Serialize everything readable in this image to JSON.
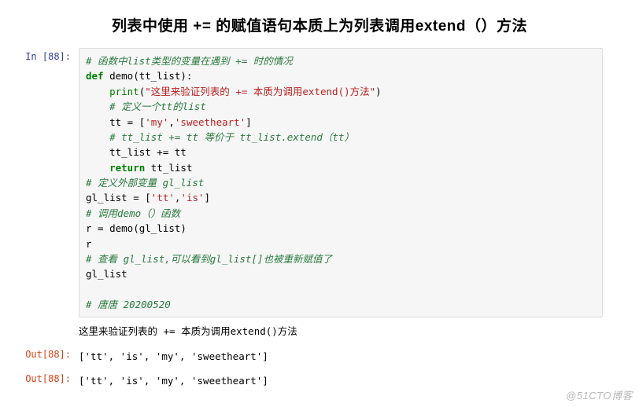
{
  "title": "列表中使用 += 的赋值语句本质上为列表调用extend（）方法",
  "in_prompt": "In  [88]:",
  "code": {
    "l1": "# 函数中list类型的变量在遇到 += 时的情况",
    "l2_kw": "def",
    "l2_name": " demo(tt_list):",
    "l3_print": "print",
    "l3_str": "\"这里来验证列表的 += 本质为调用extend()方法\"",
    "l4": "    # 定义一个tt的list",
    "l5_a": "    tt = [",
    "l5_s1": "'my'",
    "l5_c": ",",
    "l5_s2": "'sweetheart'",
    "l5_b": "]",
    "l6": "    # tt_list += tt 等价于 tt_list.extend（tt）",
    "l7": "    tt_list += tt",
    "l8_kw": "return",
    "l8_t": " tt_list",
    "l9": "# 定义外部变量 gl_list",
    "l10_a": "gl_list = [",
    "l10_s1": "'tt'",
    "l10_c": ",",
    "l10_s2": "'is'",
    "l10_b": "]",
    "l11": "# 调用demo（）函数",
    "l12": "r = demo(gl_list)",
    "l13": "r",
    "l14": "# 查看 gl_list,可以看到gl_list[]也被重新赋值了",
    "l15": "gl_list",
    "l16": "",
    "l17": "# 唐唐 20200520"
  },
  "stdout": "这里来验证列表的 += 本质为调用extend()方法",
  "out_prompt": "Out[88]:",
  "out_value": "['tt', 'is', 'my', 'sweetheart']",
  "watermark": "@51CTO博客"
}
